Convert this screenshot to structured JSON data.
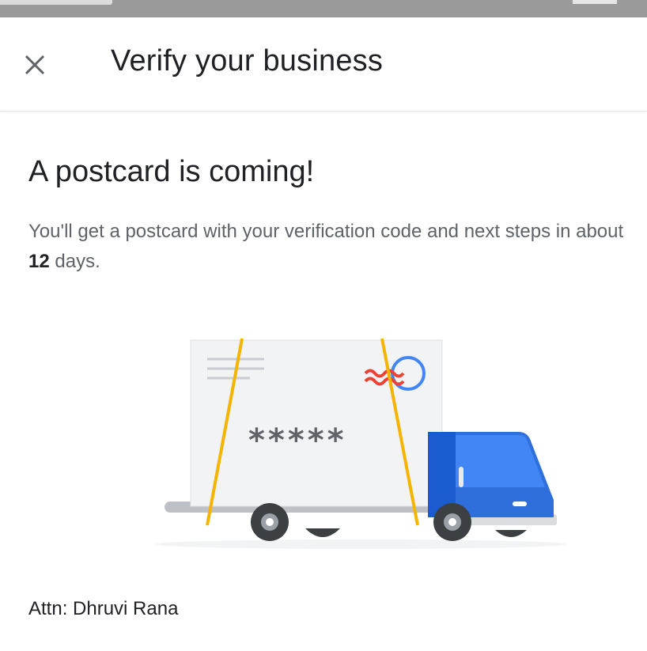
{
  "app_bar": {
    "title": "Verify your business",
    "close_icon": "close-icon"
  },
  "main": {
    "headline": "A postcard is coming!",
    "description_prefix": "You'll get a postcard with your verification code and next steps in about ",
    "days": "12",
    "description_suffix": " days.",
    "postcard_code_mask": "*****",
    "attn_text": "Attn: Dhruvi Rana"
  },
  "colors": {
    "truck_blue": "#2f6fdc",
    "strap_yellow": "#f4b400",
    "stamp_red": "#ea4335",
    "stamp_blue": "#4285f4"
  },
  "icons": {
    "illustration": "postcard-truck-illustration"
  }
}
